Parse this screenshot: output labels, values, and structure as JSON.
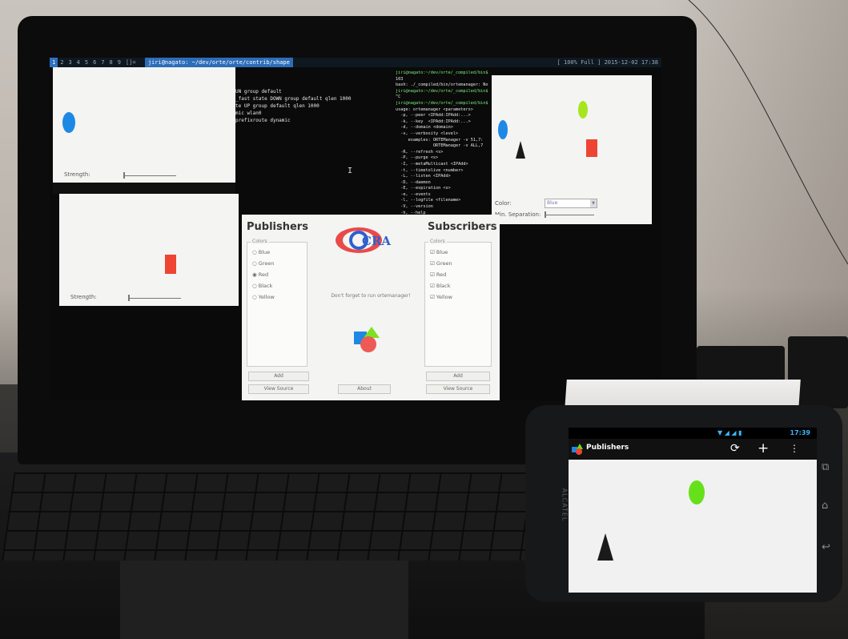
{
  "topbar": {
    "workspaces": [
      "1",
      "2",
      "3",
      "4",
      "5",
      "6",
      "7",
      "8",
      "9",
      "[]="
    ],
    "window_title": "jiri@nagato: ~/dev/orte/orte/contrib/shape",
    "status": "[ 100% Full ] 2015-12-02 17:38"
  },
  "terminal_mid": {
    "lines": [
      "UN group default",
      "",
      "",
      "_fast state DOWN group default qlen 1000",
      "",
      "te UP group default qlen 1000",
      "",
      "mic wlan0",
      "",
      "",
      "",
      "prefixroute dynamic"
    ]
  },
  "terminal_right": {
    "lines": [
      "jiri@nagato:~/dev/orte/_compiled/bin$",
      "103",
      "bash: ./_compiled/bin/ortemanager: No",
      "jiri@nagato:~/dev/orte/_compiled/bin$",
      "^C",
      "jiri@nagato:~/dev/orte/_compiled/bin$",
      "usage: ortemanager <parameters>",
      "  -p, --peer <IPAdd:IPAdd:...>",
      "  -k, --key  <IPAdd:IPAdd:...>",
      "  -d, --domain <domain>",
      "  -v, --verbosity <level>",
      "     examples: ORTEManager -v 51,7:",
      "               ORTEManager -v ALL,7",
      "  -R, --refresh <s>",
      "  -P, --purge <s>",
      "  -I, --metaMulticast <IPAdd>",
      "  -t, --timetolive <number>",
      "  -L, --listen <IPAdd>",
      "  -D, --daemon",
      "  -E, --expiration <s>",
      "  -e, --events",
      "  -l, --logfile <filename>",
      "  -V, --version",
      "  -h, --help"
    ]
  },
  "left_top_window": {
    "strength_label": "Strength:"
  },
  "left_bottom_window": {
    "strength_label": "Strength:"
  },
  "right_window": {
    "color_label": "Color:",
    "color_value": "Blue",
    "separation_label": "Min. Separation:"
  },
  "app": {
    "publishers_title": "Publishers",
    "subscribers_title": "Subscribers",
    "colors_group": "Colors",
    "publisher_colors": [
      "Blue",
      "Green",
      "Red",
      "Black",
      "Yellow"
    ],
    "subscriber_colors": [
      "Blue",
      "Green",
      "Red",
      "Black",
      "Yellow"
    ],
    "logo_text": "CRA",
    "message": "Don't forget to run ortemanager!",
    "add_label": "Add",
    "view_source_label": "View Source",
    "about_label": "About"
  },
  "phone": {
    "time": "17:39",
    "app_title": "Publishers",
    "brand": "ALCATEL"
  },
  "colors": {
    "blue": "#1e88e5",
    "green": "#66e01a",
    "red": "#ee4433",
    "black": "#1a1a1a",
    "term_green": "#7cf07c"
  }
}
